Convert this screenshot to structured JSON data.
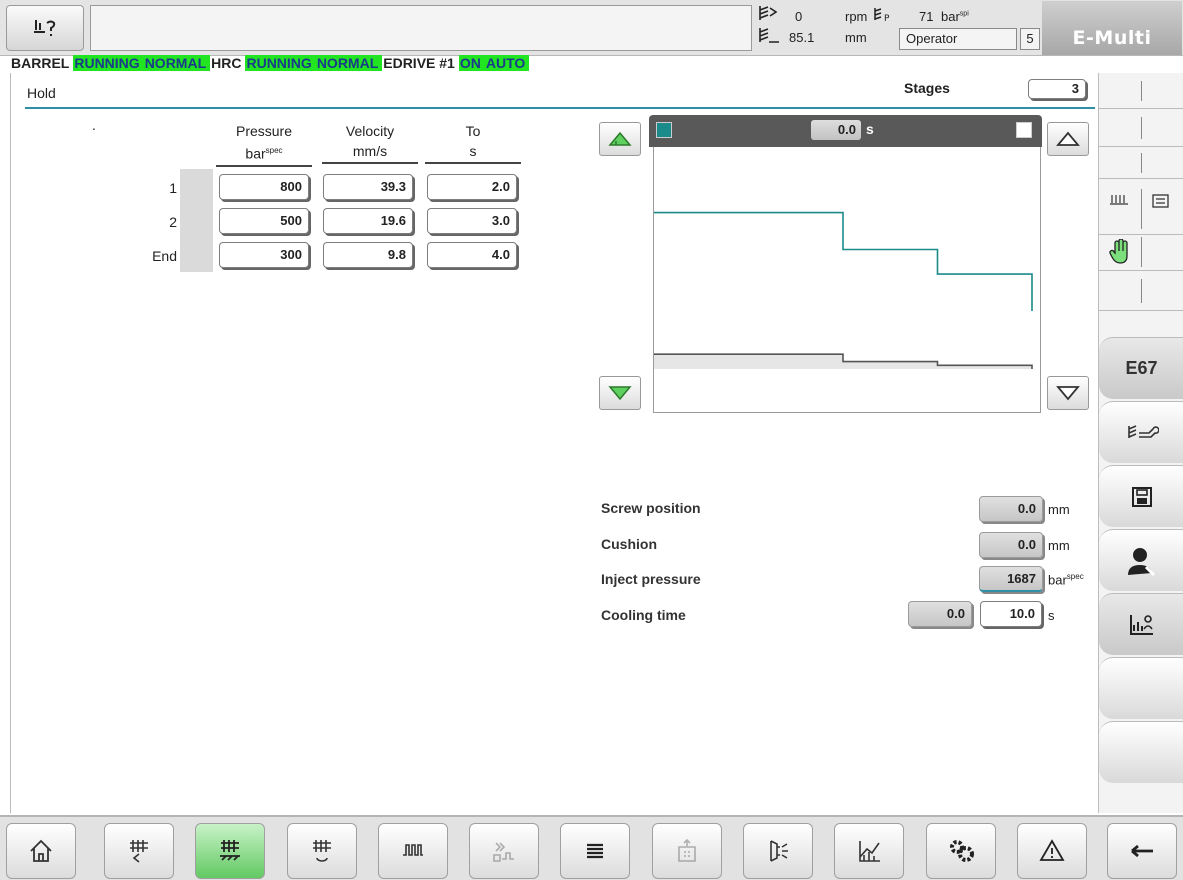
{
  "header": {
    "screw_speed_value": "0",
    "screw_speed_unit": "rpm",
    "screw_position_value": "85.1",
    "screw_position_unit": "mm",
    "pressure_value": "71",
    "pressure_unit": "bar",
    "pressure_unit_sup": "spi",
    "user": "Operator",
    "user_level": "5",
    "logo": "E-Multi"
  },
  "status": [
    {
      "text": "BARREL",
      "style": "label"
    },
    {
      "text": "RUNNING",
      "style": "green"
    },
    {
      "text": "NORMAL",
      "style": "green"
    },
    {
      "text": "HRC",
      "style": "label"
    },
    {
      "text": "RUNNING",
      "style": "green"
    },
    {
      "text": "NORMAL",
      "style": "green"
    },
    {
      "text": "EDRIVE #1",
      "style": "label"
    },
    {
      "text": "ON",
      "style": "green"
    },
    {
      "text": "AUTO",
      "style": "green"
    }
  ],
  "page": {
    "title": "Hold",
    "stages_label": "Stages",
    "stages_value": "3",
    "dot": "."
  },
  "table": {
    "columns": [
      {
        "label": "Pressure",
        "unit": "bar",
        "unit_sup": "spec"
      },
      {
        "label": "Velocity",
        "unit": "mm/s",
        "unit_sup": ""
      },
      {
        "label": "To",
        "unit": "s",
        "unit_sup": ""
      }
    ],
    "rows": [
      {
        "label": "1",
        "pressure": "800",
        "velocity": "39.3",
        "to": "2.0"
      },
      {
        "label": "2",
        "pressure": "500",
        "velocity": "19.6",
        "to": "3.0"
      },
      {
        "label": "End",
        "pressure": "300",
        "velocity": "9.8",
        "to": "4.0"
      }
    ]
  },
  "graph": {
    "time_value": "0.0",
    "time_unit": "s",
    "colors": {
      "pressure": "#1a8a8a",
      "velocity": "#555555",
      "fill": "#e6e6e6"
    }
  },
  "chart_data": {
    "type": "line",
    "x": [
      0,
      2,
      3,
      4
    ],
    "series": [
      {
        "values": [
          800,
          500,
          300,
          0
        ]
      },
      {
        "values": [
          39.3,
          19.6,
          9.8,
          0
        ]
      }
    ]
  },
  "readouts": {
    "screw_position": {
      "label": "Screw position",
      "value": "0.0",
      "unit": "mm"
    },
    "cushion": {
      "label": "Cushion",
      "value": "0.0",
      "unit": "mm"
    },
    "inject_pressure": {
      "label": "Inject pressure",
      "value": "1687",
      "unit": "bar",
      "unit_sup": "spec"
    },
    "cooling_time": {
      "label": "Cooling time",
      "actual": "0.0",
      "setpoint": "10.0",
      "unit": "s"
    }
  },
  "sidebar": {
    "e67_label": "E67",
    "buttons": [
      "barrel-wrench-icon",
      "save-icon",
      "operator-icon",
      "chart-person-icon"
    ]
  },
  "bottom_nav": [
    "home-icon",
    "barrel-back-icon",
    "barrel-heat-icon",
    "barrel-screw-icon",
    "heater-icon",
    "ejector-icon",
    "list-icon",
    "mold-icon",
    "door-icon",
    "graph-icon",
    "settings-icon",
    "alarm-icon",
    "back-arrow-icon"
  ]
}
